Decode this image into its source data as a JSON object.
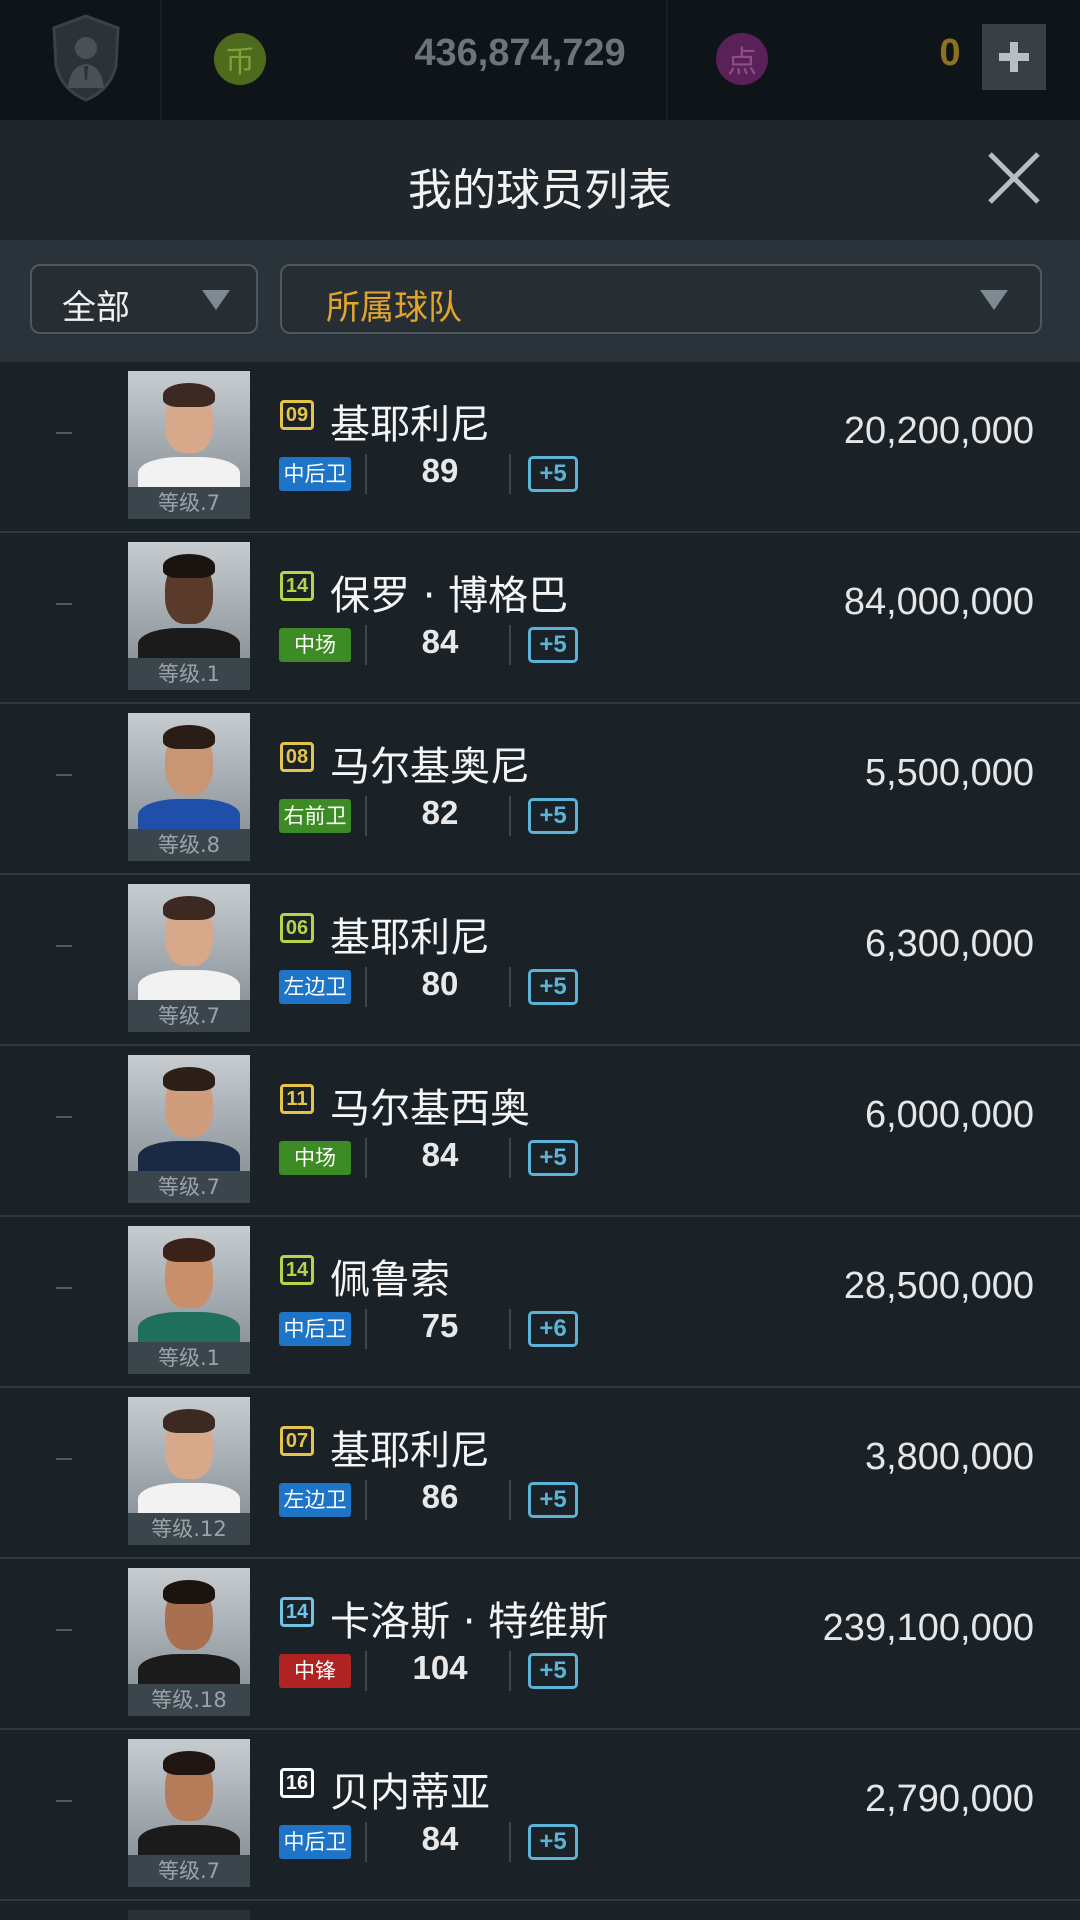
{
  "topbar": {
    "gold_icon": "币",
    "gold_amount": "436,874,729",
    "point_icon": "点",
    "point_amount": "0",
    "colors": {
      "gold": "#4e6b1d",
      "point": "#5a2158"
    }
  },
  "title": "我的球员列表",
  "filters": {
    "category": "全部",
    "team": "所属球队"
  },
  "players": [
    {
      "season": "09",
      "season_color": "#e6c44a",
      "name": "基耶利尼",
      "pos": "中后卫",
      "pos_color": "#1e74c6",
      "rating": "89",
      "boost": "+5",
      "level": "等级.7",
      "value": "20,200,000",
      "skin": "#d7a98a",
      "hair": "#3c2a22",
      "shirt": "#f2f2f2"
    },
    {
      "season": "14",
      "season_color": "#b8d24a",
      "name": "保罗 · 博格巴",
      "pos": "中场",
      "pos_color": "#3d8b24",
      "rating": "84",
      "boost": "+5",
      "level": "等级.1",
      "value": "84,000,000",
      "skin": "#5a3a2a",
      "hair": "#1a1410",
      "shirt": "#1b1b1b"
    },
    {
      "season": "08",
      "season_color": "#e6c44a",
      "name": "马尔基奥尼",
      "pos": "右前卫",
      "pos_color": "#3d8b24",
      "rating": "82",
      "boost": "+5",
      "level": "等级.8",
      "value": "5,500,000",
      "skin": "#c99675",
      "hair": "#2a1d16",
      "shirt": "#1f4fa8"
    },
    {
      "season": "06",
      "season_color": "#b8d24a",
      "name": "基耶利尼",
      "pos": "左边卫",
      "pos_color": "#1e74c6",
      "rating": "80",
      "boost": "+5",
      "level": "等级.7",
      "value": "6,300,000",
      "skin": "#d7a98a",
      "hair": "#3c2a22",
      "shirt": "#f2f2f2"
    },
    {
      "season": "11",
      "season_color": "#e6c44a",
      "name": "马尔基西奥",
      "pos": "中场",
      "pos_color": "#3d8b24",
      "rating": "84",
      "boost": "+5",
      "level": "等级.7",
      "value": "6,000,000",
      "skin": "#cf9c7c",
      "hair": "#2b1f18",
      "shirt": "#1a2a44"
    },
    {
      "season": "14",
      "season_color": "#b8d24a",
      "name": "佩鲁索",
      "pos": "中后卫",
      "pos_color": "#1e74c6",
      "rating": "75",
      "boost": "+6",
      "level": "等级.1",
      "value": "28,500,000",
      "skin": "#c98e6a",
      "hair": "#3a2218",
      "shirt": "#1f6f5a"
    },
    {
      "season": "07",
      "season_color": "#e6c44a",
      "name": "基耶利尼",
      "pos": "左边卫",
      "pos_color": "#1e74c6",
      "rating": "86",
      "boost": "+5",
      "level": "等级.12",
      "value": "3,800,000",
      "skin": "#d7a98a",
      "hair": "#3c2a22",
      "shirt": "#f2f2f2"
    },
    {
      "season": "14",
      "season_color": "#6fc5e8",
      "name": "卡洛斯 · 特维斯",
      "pos": "中锋",
      "pos_color": "#b02323",
      "rating": "104",
      "boost": "+5",
      "level": "等级.18",
      "value": "239,100,000",
      "skin": "#a8704e",
      "hair": "#1a1410",
      "shirt": "#1b1b1b"
    },
    {
      "season": "16",
      "season_color": "#ffffff",
      "name": "贝内蒂亚",
      "pos": "中后卫",
      "pos_color": "#1e74c6",
      "rating": "84",
      "boost": "+5",
      "level": "等级.7",
      "value": "2,790,000",
      "skin": "#b57c5a",
      "hair": "#1f1612",
      "shirt": "#1b1b1b"
    }
  ]
}
